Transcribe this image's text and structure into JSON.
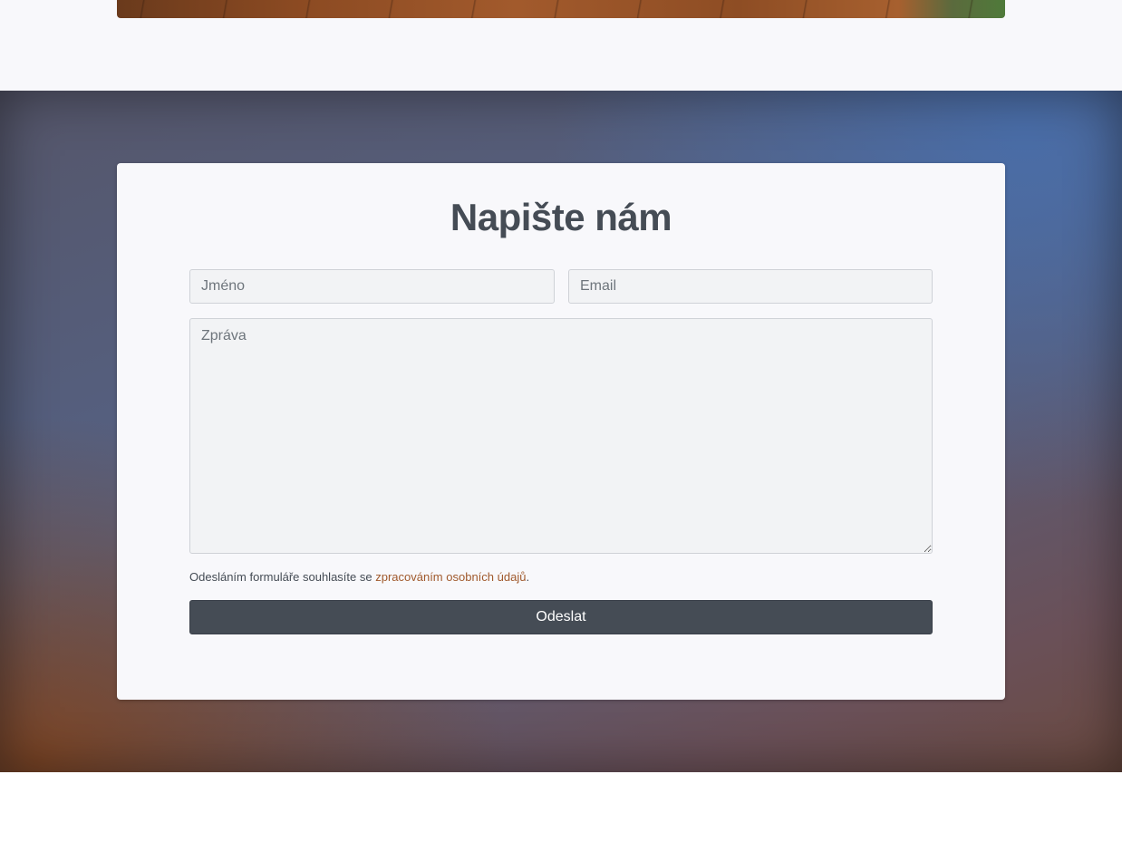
{
  "contact_form": {
    "title": "Napište nám",
    "name_placeholder": "Jméno",
    "email_placeholder": "Email",
    "message_placeholder": "Zpráva",
    "consent_prefix": "Odesláním formuláře souhlasíte se ",
    "consent_link": "zpracováním osobních údajů",
    "consent_suffix": ".",
    "submit_label": "Odeslat"
  },
  "colors": {
    "text": "#454c55",
    "button": "#454c55",
    "link": "#a0592c",
    "card": "#f8f8fb"
  }
}
